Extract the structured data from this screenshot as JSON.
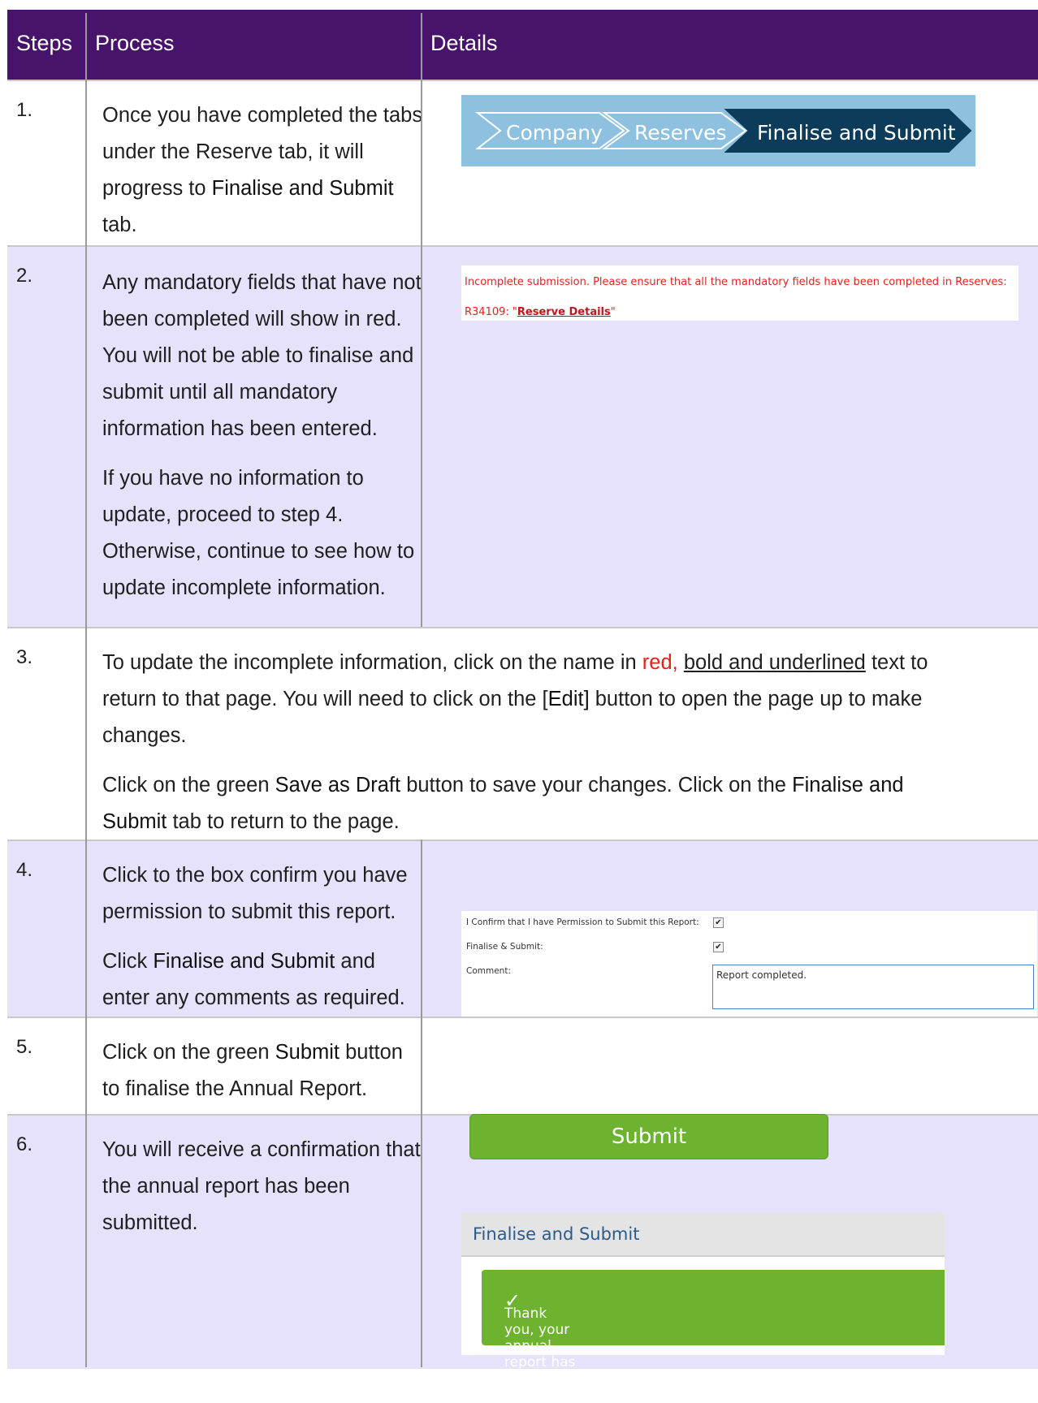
{
  "header": {
    "steps": "Steps",
    "process": "Process",
    "details": "Details"
  },
  "rows": [
    {
      "num": "1.",
      "text_a": "Once you have completed the tabs under the Reserve tab, it will progress to ",
      "text_b": "Finalise and Submit",
      "text_c": " tab."
    },
    {
      "num": "2.",
      "p1": "Any mandatory fields that have not been completed will show in red. You will not be able to finalise and submit until all mandatory information has been entered.",
      "p2": "If you have no information to update, proceed to step 4. Otherwise, continue to see how to update incomplete information."
    },
    {
      "num": "3.",
      "p1a": "To update the incomplete information, click on the name in ",
      "p1red": "red,",
      "p1sp": " ",
      "p1ul": "bold and underlined",
      "p1b": " text to return to that page. You will need to click on the [",
      "p1edit": "Edit]",
      "p1c": " button to open the page up to make changes.",
      "p2a": "Click on the green ",
      "p2save": "Save as Draft",
      "p2b": " button to save your changes. Click on the ",
      "p2fin": "Finalise and Submit",
      "p2c": " tab to return to the page."
    },
    {
      "num": "4.",
      "p1": "Click to the box confirm you have permission to submit this report.",
      "p2a": "Click ",
      "p2fin": "Finalise and Submit",
      "p2b": " and enter any comments as required."
    },
    {
      "num": "5.",
      "t1": "Click on the green ",
      "t2": "Submit",
      "t3": " button to finalise the Annual Report."
    },
    {
      "num": "6.",
      "t1": "You will receive a confirmation that the annual report has been submitted."
    }
  ],
  "breadcrumb": {
    "company": "Company",
    "reserves": "Reserves",
    "finalise": "Finalise and Submit"
  },
  "error": {
    "line1": "Incomplete submission. Please ensure that all the mandatory fields have been completed in Reserves:",
    "prefix": "R34109: \"",
    "link": "Reserve Details",
    "suffix": "\""
  },
  "form": {
    "confirm_label": "I Confirm that I have Permission to Submit this Report:",
    "finalise_label": "Finalise & Submit:",
    "comment_label": "Comment:",
    "comment_value": "Report completed.",
    "check": "✔"
  },
  "submit_button": "Submit",
  "confirmation": {
    "title": "Finalise and Submit",
    "check": "✓",
    "message": "Thank you, your annual report has been submitted."
  },
  "colors": {
    "header": "#47136b",
    "row_alt": "#e6e2fc",
    "green": "#6db330",
    "red": "#e6211c",
    "breadcrumb_dark": "#0c3c5a",
    "breadcrumb_light": "#8ec1e0"
  }
}
